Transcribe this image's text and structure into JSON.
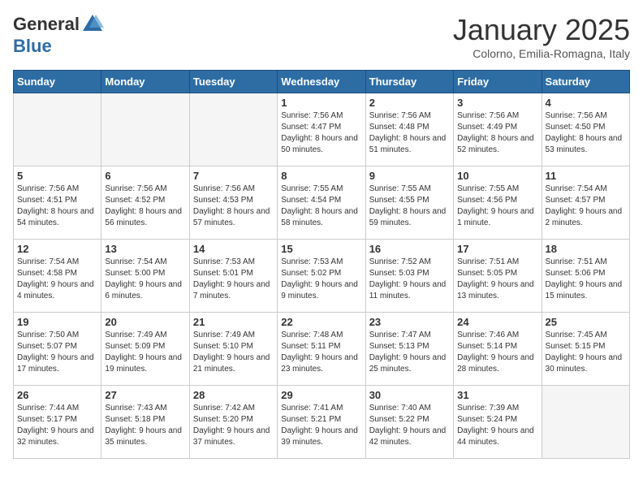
{
  "header": {
    "logo_general": "General",
    "logo_blue": "Blue",
    "month_title": "January 2025",
    "location": "Colorno, Emilia-Romagna, Italy"
  },
  "weekdays": [
    "Sunday",
    "Monday",
    "Tuesday",
    "Wednesday",
    "Thursday",
    "Friday",
    "Saturday"
  ],
  "weeks": [
    [
      {
        "day": "",
        "sunrise": "",
        "sunset": "",
        "daylight": "",
        "empty": true
      },
      {
        "day": "",
        "sunrise": "",
        "sunset": "",
        "daylight": "",
        "empty": true
      },
      {
        "day": "",
        "sunrise": "",
        "sunset": "",
        "daylight": "",
        "empty": true
      },
      {
        "day": "1",
        "sunrise": "Sunrise: 7:56 AM",
        "sunset": "Sunset: 4:47 PM",
        "daylight": "Daylight: 8 hours and 50 minutes."
      },
      {
        "day": "2",
        "sunrise": "Sunrise: 7:56 AM",
        "sunset": "Sunset: 4:48 PM",
        "daylight": "Daylight: 8 hours and 51 minutes."
      },
      {
        "day": "3",
        "sunrise": "Sunrise: 7:56 AM",
        "sunset": "Sunset: 4:49 PM",
        "daylight": "Daylight: 8 hours and 52 minutes."
      },
      {
        "day": "4",
        "sunrise": "Sunrise: 7:56 AM",
        "sunset": "Sunset: 4:50 PM",
        "daylight": "Daylight: 8 hours and 53 minutes."
      }
    ],
    [
      {
        "day": "5",
        "sunrise": "Sunrise: 7:56 AM",
        "sunset": "Sunset: 4:51 PM",
        "daylight": "Daylight: 8 hours and 54 minutes."
      },
      {
        "day": "6",
        "sunrise": "Sunrise: 7:56 AM",
        "sunset": "Sunset: 4:52 PM",
        "daylight": "Daylight: 8 hours and 56 minutes."
      },
      {
        "day": "7",
        "sunrise": "Sunrise: 7:56 AM",
        "sunset": "Sunset: 4:53 PM",
        "daylight": "Daylight: 8 hours and 57 minutes."
      },
      {
        "day": "8",
        "sunrise": "Sunrise: 7:55 AM",
        "sunset": "Sunset: 4:54 PM",
        "daylight": "Daylight: 8 hours and 58 minutes."
      },
      {
        "day": "9",
        "sunrise": "Sunrise: 7:55 AM",
        "sunset": "Sunset: 4:55 PM",
        "daylight": "Daylight: 8 hours and 59 minutes."
      },
      {
        "day": "10",
        "sunrise": "Sunrise: 7:55 AM",
        "sunset": "Sunset: 4:56 PM",
        "daylight": "Daylight: 9 hours and 1 minute."
      },
      {
        "day": "11",
        "sunrise": "Sunrise: 7:54 AM",
        "sunset": "Sunset: 4:57 PM",
        "daylight": "Daylight: 9 hours and 2 minutes."
      }
    ],
    [
      {
        "day": "12",
        "sunrise": "Sunrise: 7:54 AM",
        "sunset": "Sunset: 4:58 PM",
        "daylight": "Daylight: 9 hours and 4 minutes."
      },
      {
        "day": "13",
        "sunrise": "Sunrise: 7:54 AM",
        "sunset": "Sunset: 5:00 PM",
        "daylight": "Daylight: 9 hours and 6 minutes."
      },
      {
        "day": "14",
        "sunrise": "Sunrise: 7:53 AM",
        "sunset": "Sunset: 5:01 PM",
        "daylight": "Daylight: 9 hours and 7 minutes."
      },
      {
        "day": "15",
        "sunrise": "Sunrise: 7:53 AM",
        "sunset": "Sunset: 5:02 PM",
        "daylight": "Daylight: 9 hours and 9 minutes."
      },
      {
        "day": "16",
        "sunrise": "Sunrise: 7:52 AM",
        "sunset": "Sunset: 5:03 PM",
        "daylight": "Daylight: 9 hours and 11 minutes."
      },
      {
        "day": "17",
        "sunrise": "Sunrise: 7:51 AM",
        "sunset": "Sunset: 5:05 PM",
        "daylight": "Daylight: 9 hours and 13 minutes."
      },
      {
        "day": "18",
        "sunrise": "Sunrise: 7:51 AM",
        "sunset": "Sunset: 5:06 PM",
        "daylight": "Daylight: 9 hours and 15 minutes."
      }
    ],
    [
      {
        "day": "19",
        "sunrise": "Sunrise: 7:50 AM",
        "sunset": "Sunset: 5:07 PM",
        "daylight": "Daylight: 9 hours and 17 minutes."
      },
      {
        "day": "20",
        "sunrise": "Sunrise: 7:49 AM",
        "sunset": "Sunset: 5:09 PM",
        "daylight": "Daylight: 9 hours and 19 minutes."
      },
      {
        "day": "21",
        "sunrise": "Sunrise: 7:49 AM",
        "sunset": "Sunset: 5:10 PM",
        "daylight": "Daylight: 9 hours and 21 minutes."
      },
      {
        "day": "22",
        "sunrise": "Sunrise: 7:48 AM",
        "sunset": "Sunset: 5:11 PM",
        "daylight": "Daylight: 9 hours and 23 minutes."
      },
      {
        "day": "23",
        "sunrise": "Sunrise: 7:47 AM",
        "sunset": "Sunset: 5:13 PM",
        "daylight": "Daylight: 9 hours and 25 minutes."
      },
      {
        "day": "24",
        "sunrise": "Sunrise: 7:46 AM",
        "sunset": "Sunset: 5:14 PM",
        "daylight": "Daylight: 9 hours and 28 minutes."
      },
      {
        "day": "25",
        "sunrise": "Sunrise: 7:45 AM",
        "sunset": "Sunset: 5:15 PM",
        "daylight": "Daylight: 9 hours and 30 minutes."
      }
    ],
    [
      {
        "day": "26",
        "sunrise": "Sunrise: 7:44 AM",
        "sunset": "Sunset: 5:17 PM",
        "daylight": "Daylight: 9 hours and 32 minutes."
      },
      {
        "day": "27",
        "sunrise": "Sunrise: 7:43 AM",
        "sunset": "Sunset: 5:18 PM",
        "daylight": "Daylight: 9 hours and 35 minutes."
      },
      {
        "day": "28",
        "sunrise": "Sunrise: 7:42 AM",
        "sunset": "Sunset: 5:20 PM",
        "daylight": "Daylight: 9 hours and 37 minutes."
      },
      {
        "day": "29",
        "sunrise": "Sunrise: 7:41 AM",
        "sunset": "Sunset: 5:21 PM",
        "daylight": "Daylight: 9 hours and 39 minutes."
      },
      {
        "day": "30",
        "sunrise": "Sunrise: 7:40 AM",
        "sunset": "Sunset: 5:22 PM",
        "daylight": "Daylight: 9 hours and 42 minutes."
      },
      {
        "day": "31",
        "sunrise": "Sunrise: 7:39 AM",
        "sunset": "Sunset: 5:24 PM",
        "daylight": "Daylight: 9 hours and 44 minutes."
      },
      {
        "day": "",
        "sunrise": "",
        "sunset": "",
        "daylight": "",
        "empty": true
      }
    ]
  ]
}
